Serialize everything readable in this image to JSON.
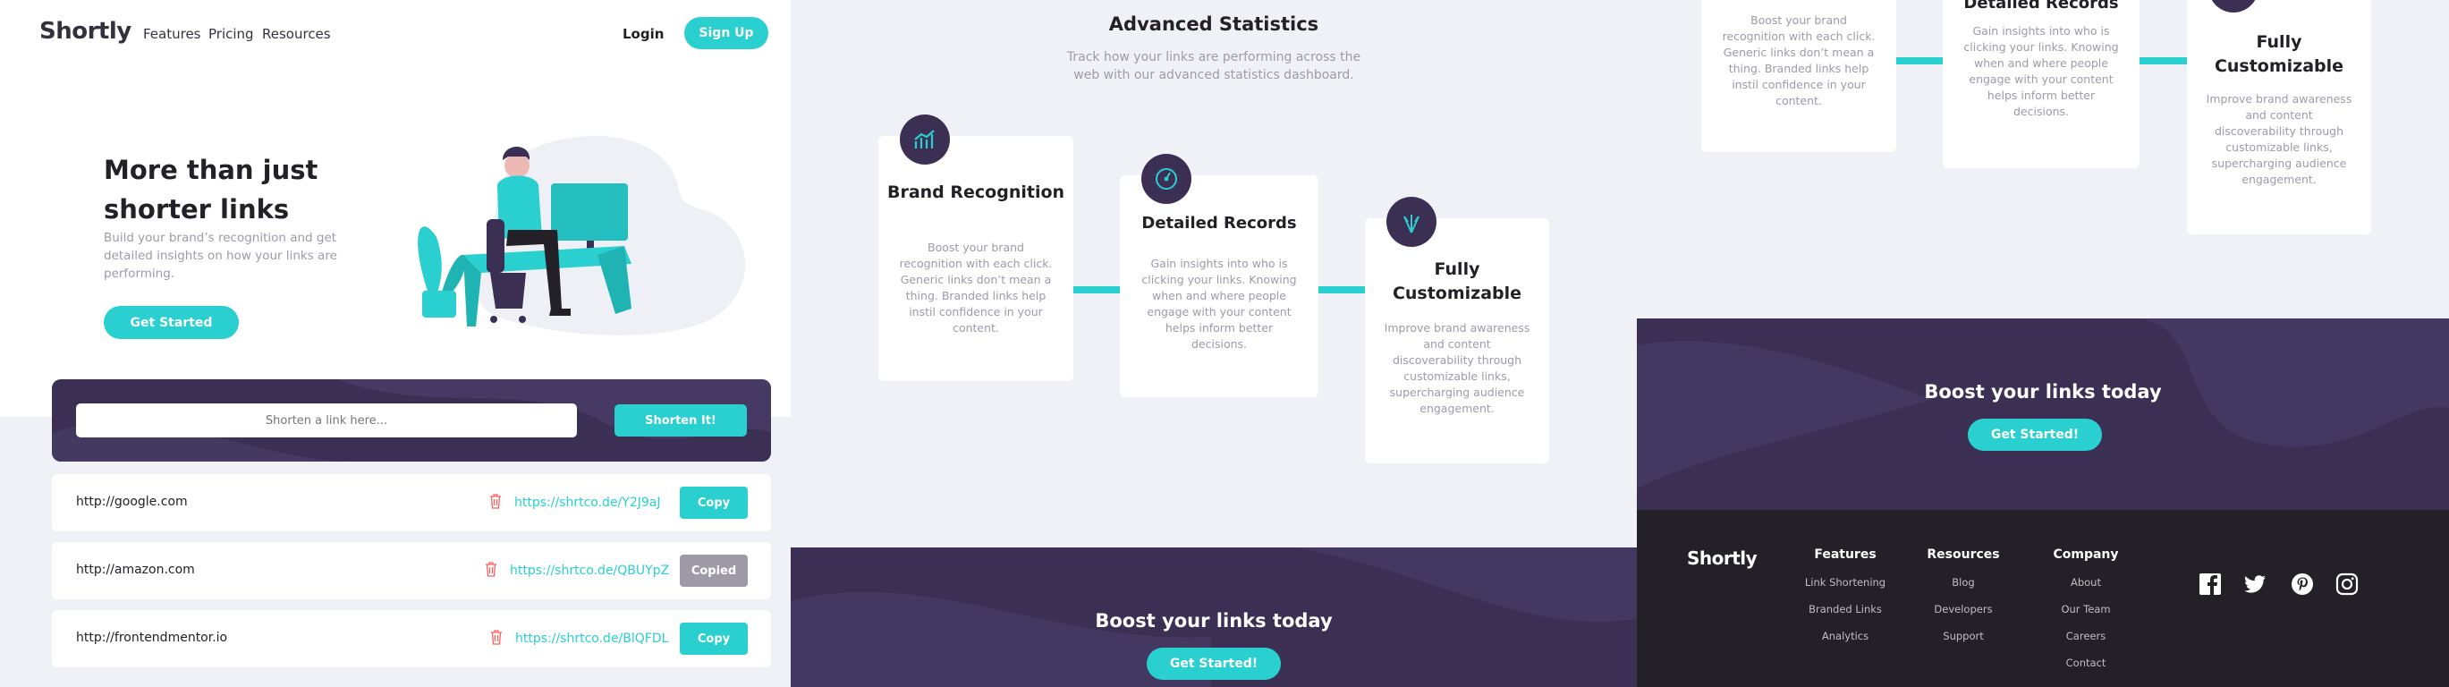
{
  "brand": "Shortly",
  "nav": {
    "links": [
      "Features",
      "Pricing",
      "Resources"
    ],
    "login": "Login",
    "signup": "Sign Up"
  },
  "hero": {
    "title": "More than just shorter links",
    "subtitle": "Build your brand’s recognition and get detailed insights on how your links are performing.",
    "cta": "Get Started"
  },
  "shorten": {
    "placeholder": "Shorten a link here...",
    "button": "Shorten It!"
  },
  "links": [
    {
      "original": "http://google.com",
      "short": "https://shrtco.de/Y2J9aJ",
      "button": "Copy",
      "copied": false
    },
    {
      "original": "http://amazon.com",
      "short": "https://shrtco.de/QBUYpZ",
      "button": "Copied",
      "copied": true
    },
    {
      "original": "http://frontendmentor.io",
      "short": "https://shrtco.de/BlQFDL",
      "button": "Copy",
      "copied": false
    }
  ],
  "stats": {
    "title": "Advanced Statistics",
    "subtitle": "Track how your links are performing across the web with our advanced statistics dashboard.",
    "cards": [
      {
        "title": "Brand Recognition",
        "text": "Boost your brand recognition with each click. Generic links don’t mean a thing. Branded links help instil confidence in your content.",
        "icon": "chart-icon"
      },
      {
        "title": "Detailed Records",
        "text": "Gain insights into who is clicking your links. Knowing when and where people engage with your content helps inform better decisions.",
        "icon": "gauge-icon"
      },
      {
        "title": "Fully Customizable",
        "text": "Improve brand awareness and content discoverability through customizable links, supercharging audience engagement.",
        "icon": "brush-icon"
      }
    ]
  },
  "boost": {
    "title": "Boost your links today",
    "cta": "Get Started!"
  },
  "footer": {
    "columns": [
      {
        "title": "Features",
        "links": [
          "Link Shortening",
          "Branded Links",
          "Analytics"
        ]
      },
      {
        "title": "Resources",
        "links": [
          "Blog",
          "Developers",
          "Support"
        ]
      },
      {
        "title": "Company",
        "links": [
          "About",
          "Our Team",
          "Careers",
          "Contact"
        ]
      }
    ],
    "social": [
      "facebook-icon",
      "twitter-icon",
      "pinterest-icon",
      "instagram-icon"
    ]
  },
  "colors": {
    "cyan": "#2acfcf",
    "dark_violet": "#3b3054",
    "very_dark": "#232127",
    "gray_violet": "#9e9aa8",
    "red": "#f46262",
    "bg": "#f0f1f6"
  }
}
